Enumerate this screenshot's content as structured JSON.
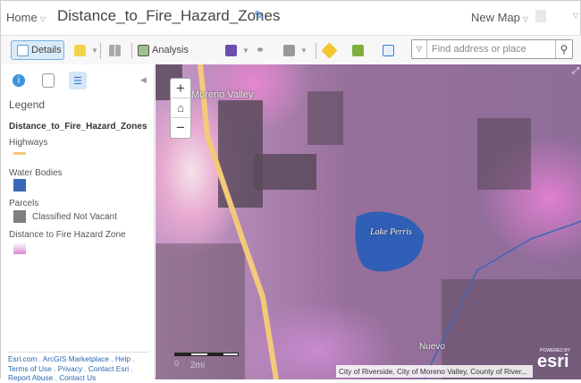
{
  "header": {
    "home": "Home",
    "title": "Distance_to_Fire_Hazard_Zones",
    "new_map": "New Map"
  },
  "toolbar": {
    "details": "Details",
    "analysis": "Analysis",
    "search_placeholder": "Find address or place"
  },
  "sidebar": {
    "legend_title": "Legend",
    "layer": "Distance_to_Fire_Hazard_Zones",
    "items": [
      {
        "label": "Highways",
        "color": "#f5c97a"
      },
      {
        "label": "Water Bodies",
        "color": "#3a67b8"
      },
      {
        "label": "Parcels",
        "sub": "Classified Not Vacant",
        "color": "#7f7f7f"
      },
      {
        "label": "Distance to Fire Hazard Zone"
      }
    ],
    "footer": {
      "l1": "Esri.com . ArcGIS Marketplace . Help .",
      "l2": "Terms of Use . Privacy . Contact Esri .",
      "l3": "Report Abuse . Contact Us"
    }
  },
  "map": {
    "labels": {
      "moreno": "Moreno Valley",
      "lake": "Lake Perris",
      "nuevo": "Nuevo"
    },
    "scale_0": "0",
    "scale_2": "2mi",
    "attribution": "City of Riverside, City of Moreno Valley, County of River...",
    "powered": "POWERED BY",
    "esri": "esri"
  }
}
